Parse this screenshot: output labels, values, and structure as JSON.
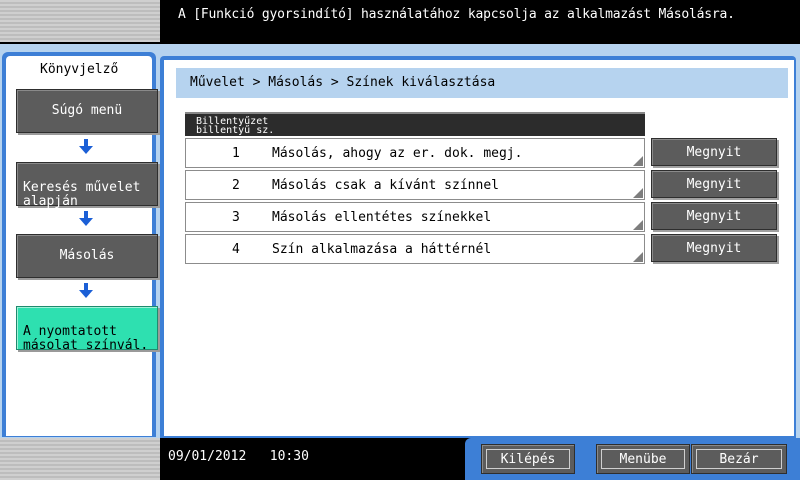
{
  "message": "A [Funkció gyorsindító] használatához kapcsolja az alkalmazást Másolásra.",
  "left_panel": {
    "title": "Könyvjelző",
    "items": [
      {
        "label": "Súgó menü"
      },
      {
        "label": "Keresés művelet\nalapján"
      },
      {
        "label": "Másolás"
      },
      {
        "label": "A nyomtatott\nmásolat színvál."
      }
    ]
  },
  "breadcrumb": "Művelet > Másolás > Színek kiválasztása",
  "table": {
    "header_line1": "Billentyűzet",
    "header_line2": "billentyű sz.",
    "rows": [
      {
        "num": "1",
        "label": "Másolás, ahogy az er. dok. megj.",
        "button": "Megnyit"
      },
      {
        "num": "2",
        "label": "Másolás csak a kívánt színnel",
        "button": "Megnyit"
      },
      {
        "num": "3",
        "label": "Másolás ellentétes színekkel",
        "button": "Megnyit"
      },
      {
        "num": "4",
        "label": "Szín alkalmazása a háttérnél",
        "button": "Megnyit"
      }
    ]
  },
  "status": {
    "date": "09/01/2012",
    "time": "10:30"
  },
  "footer_buttons": {
    "exit": "Kilépés",
    "menu": "Menübe",
    "close": "Bezár"
  },
  "colors": {
    "frame_blue": "#3d7fd6",
    "light_blue": "#b6d3ef",
    "button_grey": "#5c5c5c",
    "active_green": "#2ee0b0"
  }
}
